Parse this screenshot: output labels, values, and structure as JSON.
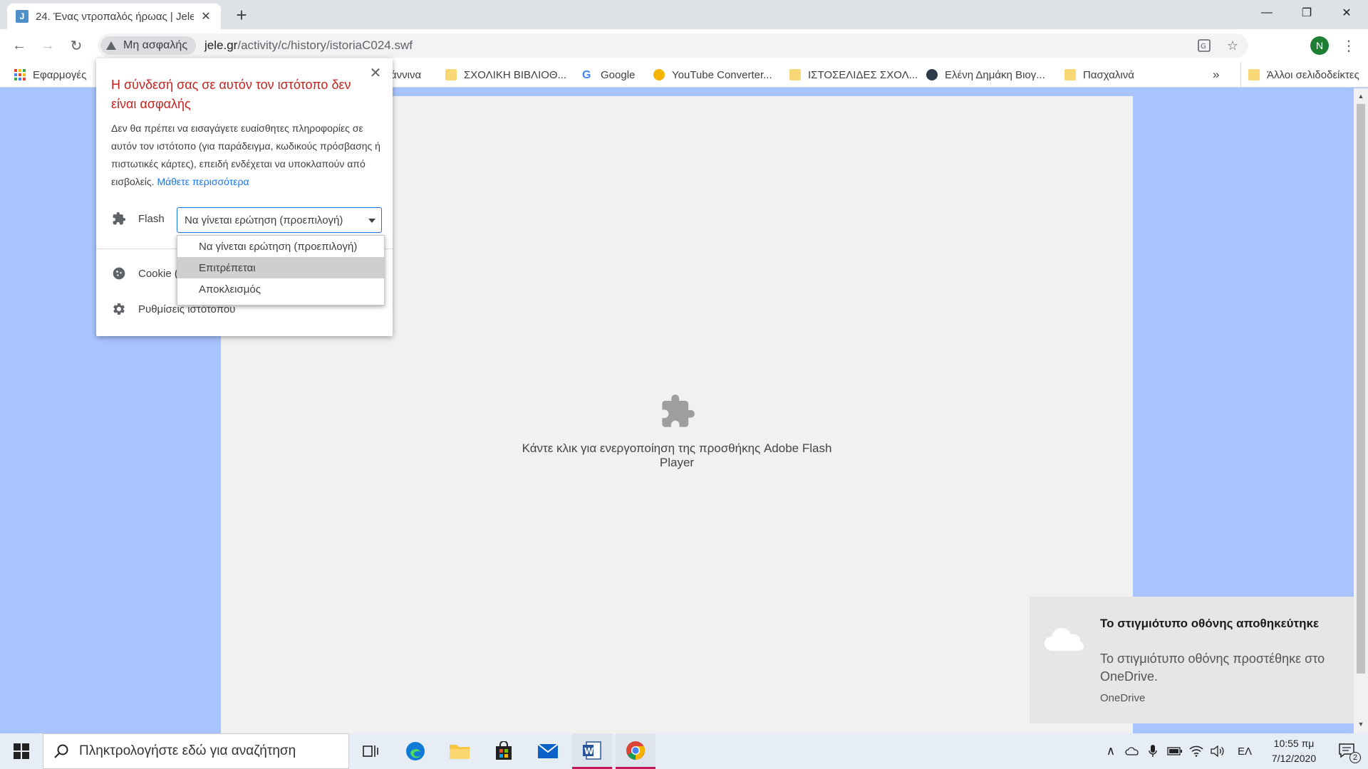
{
  "browser": {
    "tab": {
      "favicon_letter": "J",
      "title": "24. Ένας ντροπαλός ήρωας | Jele"
    },
    "security_chip": "Μη ασφαλής",
    "url": {
      "host": "jele.gr",
      "path": "/activity/c/history/istoriaC024.swf"
    },
    "profile_initial": "N"
  },
  "bookmarks": [
    {
      "label": "Εφαρμογές",
      "icon": "apps-icon"
    },
    {
      "label": "άννινα",
      "icon": "none"
    },
    {
      "label": "ΣΧΟΛΙΚΗ ΒΙΒΛΙΟΘ...",
      "icon": "folder-icon"
    },
    {
      "label": "Google",
      "icon": "google-icon"
    },
    {
      "label": "YouTube Converter...",
      "icon": "youtube-converter-icon"
    },
    {
      "label": "ΙΣΤΟΣΕΛΙΔΕΣ ΣΧΟΛ...",
      "icon": "folder-icon"
    },
    {
      "label": "Ελένη Δημάκη Βιογ...",
      "icon": "site-icon"
    },
    {
      "label": "Πασχαλινά",
      "icon": "folder-icon"
    },
    {
      "label": "»",
      "icon": "overflow-icon"
    },
    {
      "label": "Άλλοι σελιδοδείκτες",
      "icon": "folder-icon"
    }
  ],
  "popup": {
    "title": "Η σύνδεσή σας σε αυτόν τον ιστότοπο δεν είναι ασφαλής",
    "body": "Δεν θα πρέπει να εισαγάγετε ευαίσθητες πληροφορίες σε αυτόν τον ιστότοπο (για παράδειγμα, κωδικούς πρόσβασης ή πιστωτικές κάρτες), επειδή ενδέχεται να υποκλαπούν από εισβολείς.",
    "learn_more": "Μάθετε περισσότερα",
    "flash_label": "Flash",
    "flash_select_value": "Να γίνεται ερώτηση (προεπιλογή)",
    "cookie_label": "Cookie (",
    "site_settings_label": "Ρυθμίσεις ιστότοπου",
    "dropdown_options": [
      "Να γίνεται ερώτηση (προεπιλογή)",
      "Επιτρέπεται",
      "Αποκλεισμός"
    ]
  },
  "page": {
    "flash_message": "Κάντε κλικ για ενεργοποίηση της προσθήκης Adobe Flash Player"
  },
  "toast": {
    "title": "Το στιγμιότυπο οθόνης αποθηκεύτηκε",
    "text": "Το στιγμιότυπο οθόνης προστέθηκε στο OneDrive.",
    "source": "OneDrive"
  },
  "taskbar": {
    "search_placeholder": "Πληκτρολογήστε εδώ για αναζήτηση",
    "language": "ΕΛ",
    "time": "10:55 πμ",
    "date": "7/12/2020",
    "notification_count": "2"
  },
  "colors": {
    "page_background": "#a8c4ff",
    "warning_red": "#c5221f",
    "link_blue": "#1a73e8",
    "profile_green": "#1e7e34"
  }
}
